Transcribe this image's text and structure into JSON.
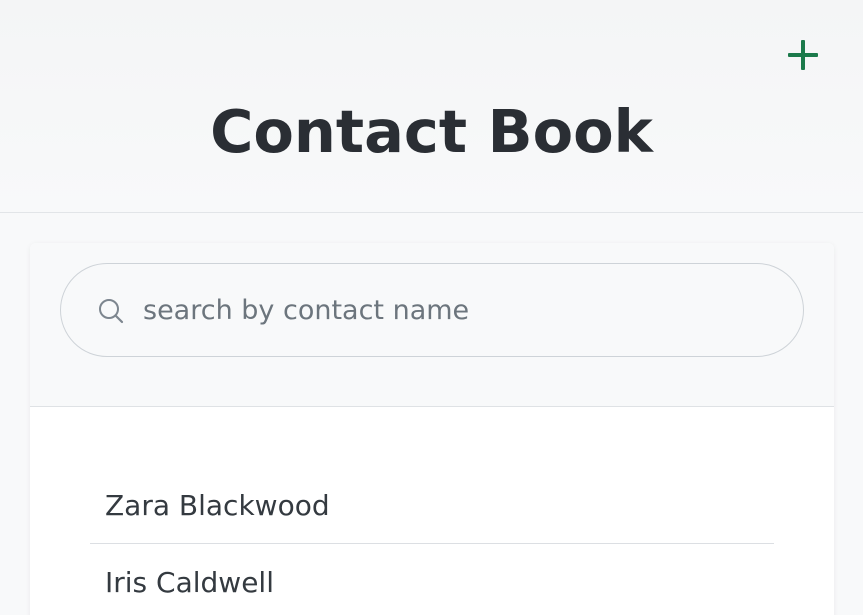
{
  "header": {
    "title": "Contact Book",
    "add_icon": "plus-icon",
    "accent_color": "#1b7a4b"
  },
  "search": {
    "placeholder": "search by contact name",
    "value": "",
    "icon": "search-icon"
  },
  "contacts": [
    {
      "name": "Zara Blackwood"
    },
    {
      "name": "Iris Caldwell"
    }
  ]
}
